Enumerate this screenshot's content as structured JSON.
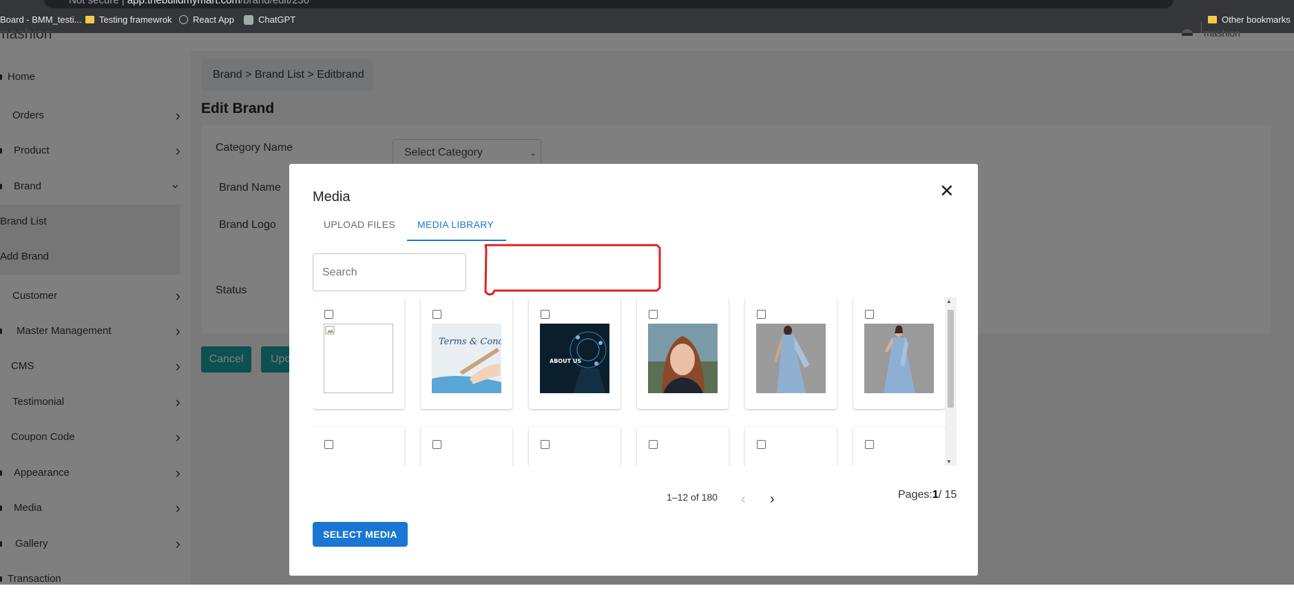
{
  "browser": {
    "url_security": "Not secure",
    "url_host": "app.thebuildmymart.com",
    "url_path": "/brand/edit/230",
    "bookmarks": [
      {
        "label": "Board - BMM_testi...",
        "icon": "folder-icon"
      },
      {
        "label": "Testing framewrok",
        "icon": "folder-icon"
      },
      {
        "label": "React App",
        "icon": "globe-icon"
      },
      {
        "label": "ChatGPT",
        "icon": "chatgpt-icon"
      }
    ],
    "other_bookmarks": "Other bookmarks",
    "profile_label": "Incognito"
  },
  "app": {
    "logo_text": "mashion",
    "user_name": "mashion"
  },
  "sidebar": {
    "items": [
      {
        "label": "Home"
      },
      {
        "label": "Orders",
        "chevron": "›"
      },
      {
        "label": "Product",
        "chevron": "›"
      },
      {
        "label": "Brand",
        "chevron": "⌄"
      },
      {
        "label": "Brand List"
      },
      {
        "label": "Add Brand"
      },
      {
        "label": "Customer",
        "chevron": "›"
      },
      {
        "label": "Master Management",
        "chevron": "›"
      },
      {
        "label": "CMS",
        "chevron": "›"
      },
      {
        "label": "Testimonial",
        "chevron": "›"
      },
      {
        "label": "Coupon Code",
        "chevron": "›"
      },
      {
        "label": "Appearance",
        "chevron": "›"
      },
      {
        "label": "Media",
        "chevron": "›"
      },
      {
        "label": "Gallery",
        "chevron": "›"
      },
      {
        "label": "Transaction"
      }
    ]
  },
  "page": {
    "breadcrumb": "Brand > Brand List > Editbrand",
    "title": "Edit Brand",
    "fields": {
      "category_label": "Category Name",
      "category_value": "Select Category",
      "brand_name_label": "Brand Name",
      "brand_logo_label": "Brand Logo",
      "status_label": "Status"
    },
    "cancel_label": "Cancel",
    "update_label": "Update"
  },
  "modal": {
    "title": "Media",
    "close_glyph": "✕",
    "tabs": [
      {
        "label": "UPLOAD FILES",
        "active": false
      },
      {
        "label": "MEDIA LIBRARY",
        "active": true
      }
    ],
    "search_placeholder": "Search",
    "items": [
      {
        "kind": "broken-image",
        "checked": false
      },
      {
        "kind": "terms-and-conditions",
        "text": "Terms & Conditions",
        "checked": false
      },
      {
        "kind": "about-us",
        "text": "ABOUT US",
        "checked": false
      },
      {
        "kind": "portrait-woman",
        "checked": false
      },
      {
        "kind": "blue-saree-back",
        "checked": false
      },
      {
        "kind": "blue-saree-front",
        "checked": false
      },
      {
        "kind": "hidden",
        "checked": false
      },
      {
        "kind": "hidden",
        "checked": false
      },
      {
        "kind": "hidden",
        "checked": false
      },
      {
        "kind": "hidden",
        "checked": false
      },
      {
        "kind": "hidden",
        "checked": false
      },
      {
        "kind": "hidden",
        "checked": false
      }
    ],
    "pagination": {
      "range": "1–12 of 180",
      "pages_label": "Pages:",
      "current": "1",
      "total": "/ 15",
      "prev_glyph": "‹",
      "next_glyph": "›"
    },
    "select_button": "SELECT MEDIA"
  },
  "colors": {
    "primary": "#1976d2",
    "teal": "#1aa0a0",
    "annotation_red": "#e02020"
  }
}
